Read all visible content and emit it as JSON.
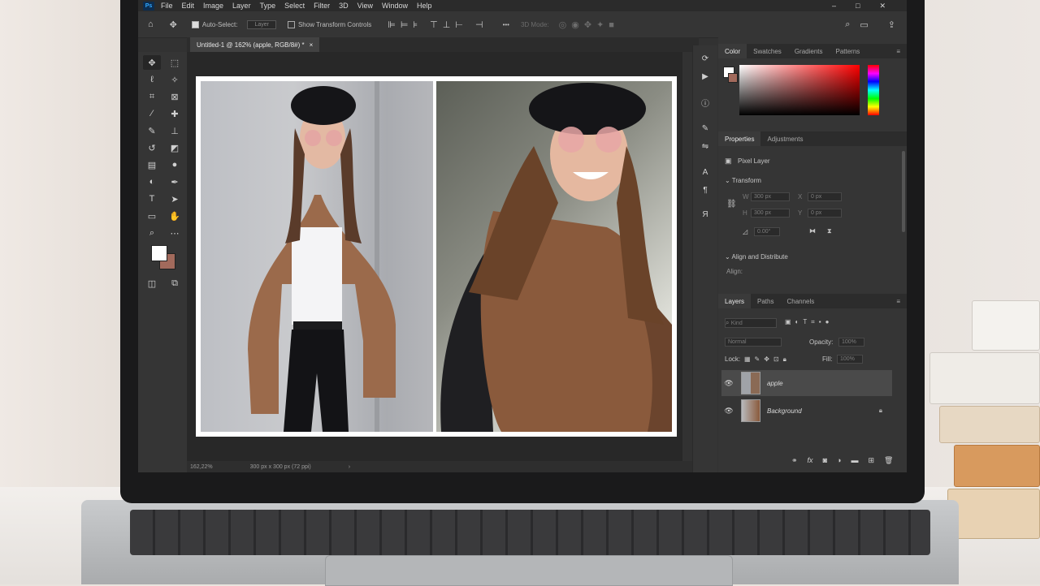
{
  "menubar": {
    "logo": "Ps",
    "items": [
      "File",
      "Edit",
      "Image",
      "Layer",
      "Type",
      "Select",
      "Filter",
      "3D",
      "View",
      "Window",
      "Help"
    ],
    "window_buttons": [
      "–",
      "□",
      "✕"
    ]
  },
  "options": {
    "auto_select_label": "Auto-Select:",
    "auto_select_target": "Layer",
    "show_transform_label": "Show Transform Controls",
    "mode_3d": "3D Mode:",
    "more": "•••"
  },
  "document_tab": {
    "title": "Untitled-1 @ 162% (apple, RGB/8#) *",
    "close": "×"
  },
  "statusbar": {
    "zoom": "162,22%",
    "doc_size": "300 px x 300 px (72 ppi)",
    "arrow": "›"
  },
  "color_panel": {
    "tabs": [
      "Color",
      "Swatches",
      "Gradients",
      "Patterns"
    ],
    "active_tab": "Color",
    "hue": "#ff0000"
  },
  "properties_panel": {
    "tabs": [
      "Properties",
      "Adjustments"
    ],
    "active_tab": "Properties",
    "layer_type": "Pixel Layer",
    "transform_section": "Transform",
    "w_label": "W",
    "w_value": "300 px",
    "h_label": "H",
    "h_value": "300 px",
    "x_label": "X",
    "x_value": "0 px",
    "y_label": "Y",
    "y_value": "0 px",
    "angle_value": "0.00°",
    "align_section": "Align and Distribute",
    "align_label": "Align:"
  },
  "layers_panel": {
    "tabs": [
      "Layers",
      "Paths",
      "Channels"
    ],
    "active_tab": "Layers",
    "search_placeholder": "Kind",
    "blend_mode": "Normal",
    "opacity_label": "Opacity:",
    "opacity_value": "100%",
    "lock_label": "Lock:",
    "fill_label": "Fill:",
    "fill_value": "100%",
    "layers": [
      {
        "name": "apple",
        "visible": true,
        "selected": true,
        "locked": false
      },
      {
        "name": "Background",
        "visible": true,
        "selected": false,
        "locked": true
      }
    ],
    "footer_icons": [
      "link-icon",
      "fx-icon",
      "mask-icon",
      "adjustment-icon",
      "group-icon",
      "new-layer-icon",
      "trash-icon"
    ]
  },
  "colors": {
    "foreground": "#ffffff",
    "background": "#a26a5c",
    "ui_dark": "#353535"
  }
}
